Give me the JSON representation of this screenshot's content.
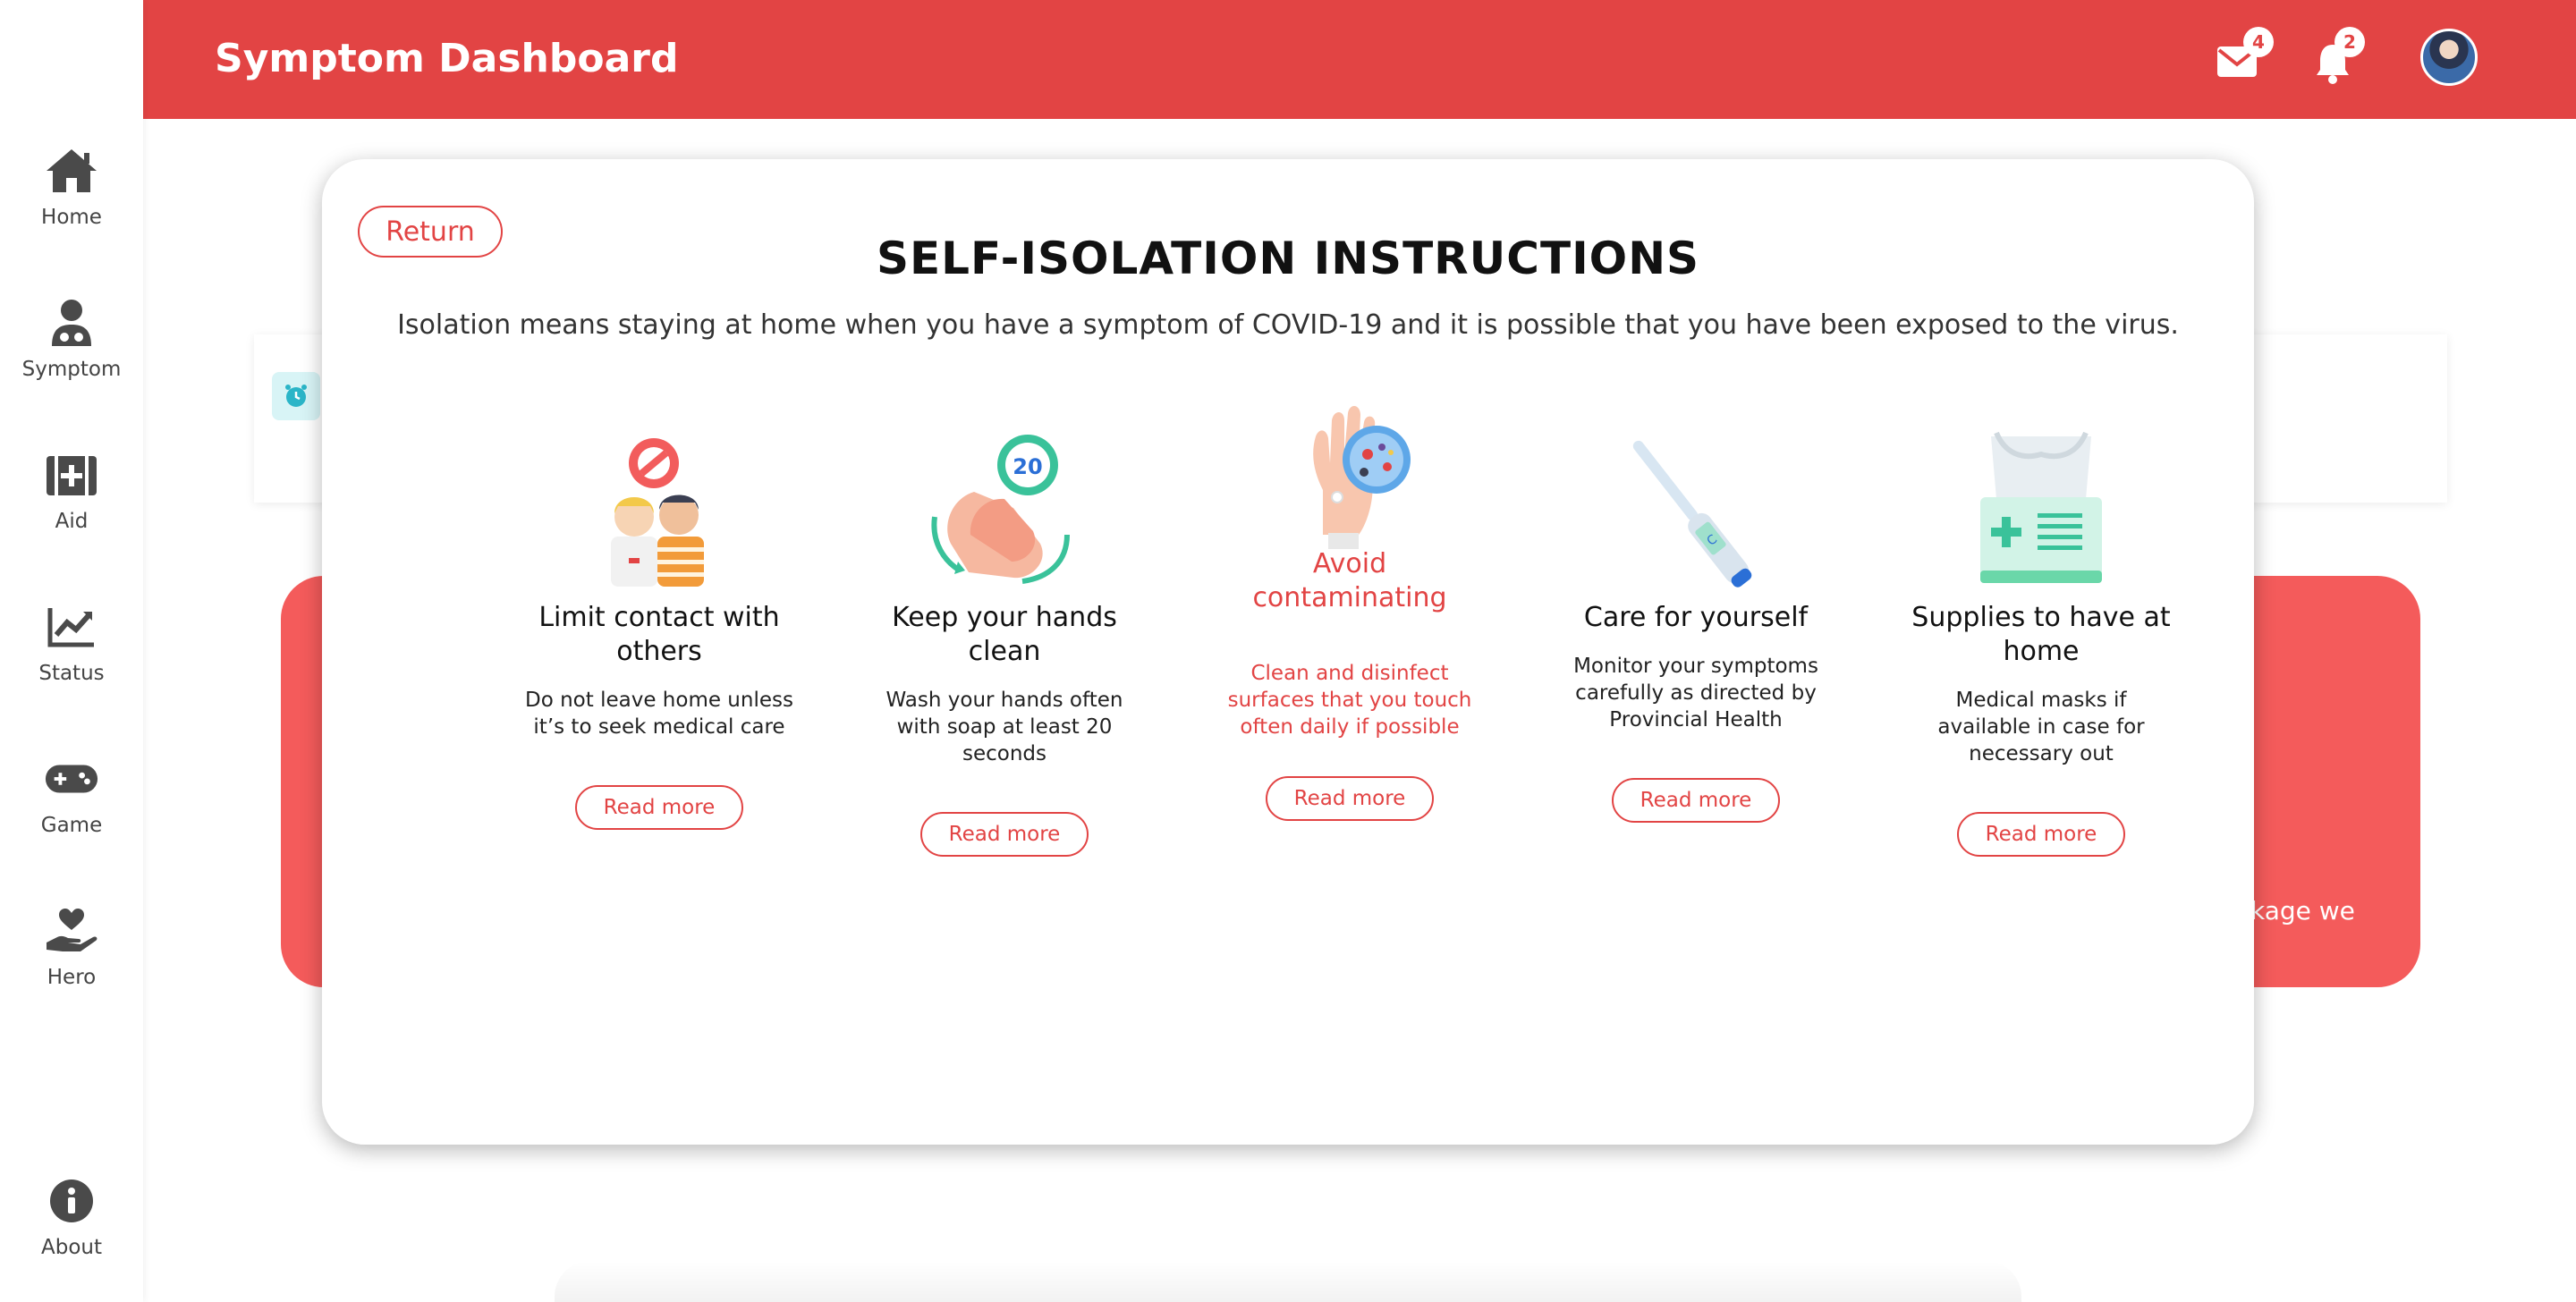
{
  "header": {
    "title": "Symptom Dashboard",
    "mail_count": "4",
    "notif_count": "2"
  },
  "sidebar": {
    "items": [
      {
        "label": "Home",
        "icon": "home-icon"
      },
      {
        "label": "Symptom",
        "icon": "doctor-icon"
      },
      {
        "label": "Aid",
        "icon": "first-aid-icon"
      },
      {
        "label": "Status",
        "icon": "chart-icon"
      },
      {
        "label": "Game",
        "icon": "gamepad-icon"
      },
      {
        "label": "Hero",
        "icon": "heart-hand-icon"
      },
      {
        "label": "About",
        "icon": "info-icon"
      }
    ]
  },
  "background": {
    "red_card_fragment": "kage we"
  },
  "modal": {
    "return_label": "Return",
    "title": "SELF-ISOLATION INSTRUCTIONS",
    "subtitle": "Isolation means staying at home when you have a symptom of COVID-19 and it is possible that you have been exposed to the virus.",
    "cards": [
      {
        "title": "Limit contact with others",
        "desc": "Do not leave home unless it’s to seek medical care",
        "button": "Read more",
        "icon": "no-contact-people-icon"
      },
      {
        "title": "Keep your hands clean",
        "desc": "Wash your hands often with soap at least 20 seconds",
        "button": "Read more",
        "icon": "hand-washing-timer-icon"
      },
      {
        "title": "Avoid contaminating",
        "desc": "Clean and disinfect surfaces that you touch often daily if possible",
        "button": "Read more",
        "icon": "hand-virus-icon"
      },
      {
        "title": "Care for yourself",
        "desc": "Monitor your symptoms carefully as directed by Provincial Health",
        "button": "Read more",
        "icon": "thermometer-icon"
      },
      {
        "title": "Supplies to have at home",
        "desc": "Medical masks if available in case for necessary out",
        "button": "Read more",
        "icon": "medical-supplies-icon"
      }
    ],
    "timer_seconds": "20"
  },
  "colors": {
    "brand_red": "#e24444",
    "card_red": "#f45b5b",
    "icon_grey": "#4a4a4a"
  }
}
